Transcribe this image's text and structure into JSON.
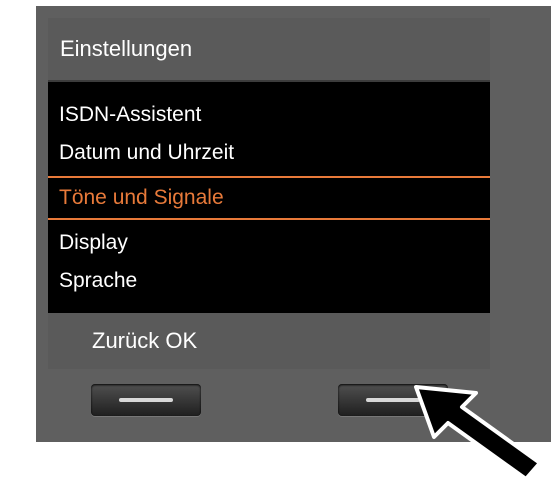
{
  "screen": {
    "title": "Einstellungen",
    "menu_items": [
      {
        "label": "ISDN-Assistent",
        "selected": false
      },
      {
        "label": "Datum und Uhrzeit",
        "selected": false
      },
      {
        "label": "Töne und Signale",
        "selected": true
      },
      {
        "label": "Display",
        "selected": false
      },
      {
        "label": "Sprache",
        "selected": false
      }
    ],
    "softkeys": {
      "left_label": "Zurück",
      "right_label": "OK"
    }
  },
  "colors": {
    "selection": "#e87a3a",
    "screen_bg": "#000000",
    "bar_bg": "#5a5a5a",
    "body": "#5f5f5f"
  },
  "icons": {
    "pointer": "pointer-arrow-icon"
  }
}
